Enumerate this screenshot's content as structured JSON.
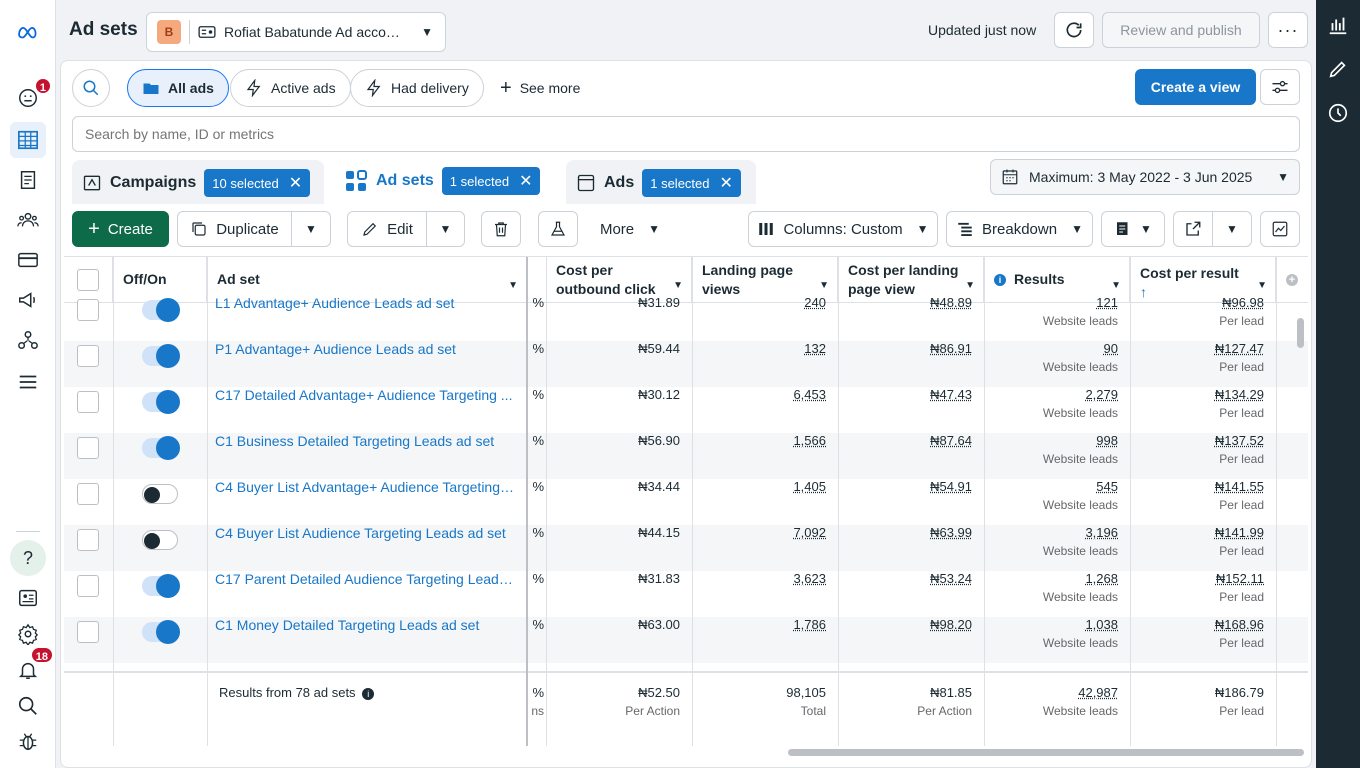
{
  "header": {
    "title": "Ad sets",
    "account_avatar": "B",
    "account_name": "Rofiat Babatunde Ad accou...",
    "updated": "Updated just now",
    "review_publish": "Review and publish"
  },
  "leftnav": {
    "notifications_badge": "1",
    "alerts_badge": "18",
    "help": "?"
  },
  "filters": {
    "all_ads": "All ads",
    "active_ads": "Active ads",
    "had_delivery": "Had delivery",
    "see_more": "See more",
    "create_view": "Create a view",
    "search_placeholder": "Search by name, ID or metrics"
  },
  "tabs": {
    "campaigns": {
      "label": "Campaigns",
      "selected": "10 selected"
    },
    "ad_sets": {
      "label": "Ad sets",
      "selected": "1 selected"
    },
    "ads": {
      "label": "Ads",
      "selected": "1 selected"
    }
  },
  "date_range": "Maximum: 3 May 2022 - 3 Jun 2025",
  "toolbar": {
    "create": "Create",
    "duplicate": "Duplicate",
    "edit": "Edit",
    "more": "More",
    "columns": "Columns: Custom",
    "breakdown": "Breakdown"
  },
  "columns": {
    "off_on": "Off/On",
    "ad_set": "Ad set",
    "cost_outbound": "Cost per outbound click",
    "landing_views": "Landing page views",
    "cost_landing": "Cost per landing page view",
    "results": "Results",
    "cost_result": "Cost per result"
  },
  "rows": [
    {
      "name": "L1 Advantage+ Audience Leads ad set",
      "on": true,
      "cpc": "₦31.89",
      "lpv": "240",
      "clpv": "₦48.89",
      "results": "121",
      "results_sub": "Website leads",
      "cpr": "₦96.98",
      "cpr_sub": "Per lead"
    },
    {
      "name": "P1 Advantage+ Audience Leads ad set",
      "on": true,
      "cpc": "₦59.44",
      "lpv": "132",
      "clpv": "₦86.91",
      "results": "90",
      "results_sub": "Website leads",
      "cpr": "₦127.47",
      "cpr_sub": "Per lead"
    },
    {
      "name": "C17 Detailed Advantage+ Audience Targeting ...",
      "on": true,
      "cpc": "₦30.12",
      "lpv": "6,453",
      "clpv": "₦47.43",
      "results": "2,279",
      "results_sub": "Website leads",
      "cpr": "₦134.29",
      "cpr_sub": "Per lead"
    },
    {
      "name": "C1 Business Detailed Targeting Leads ad set",
      "on": true,
      "cpc": "₦56.90",
      "lpv": "1,566",
      "clpv": "₦87.64",
      "results": "998",
      "results_sub": "Website leads",
      "cpr": "₦137.52",
      "cpr_sub": "Per lead"
    },
    {
      "name": "C4 Buyer List Advantage+ Audience Targeting ...",
      "on": false,
      "cpc": "₦34.44",
      "lpv": "1,405",
      "clpv": "₦54.91",
      "results": "545",
      "results_sub": "Website leads",
      "cpr": "₦141.55",
      "cpr_sub": "Per lead"
    },
    {
      "name": "C4 Buyer List Audience Targeting Leads ad set",
      "on": false,
      "cpc": "₦44.15",
      "lpv": "7,092",
      "clpv": "₦63.99",
      "results": "3,196",
      "results_sub": "Website leads",
      "cpr": "₦141.99",
      "cpr_sub": "Per lead"
    },
    {
      "name": "C17 Parent Detailed Audience Targeting Leads ...",
      "on": true,
      "cpc": "₦31.83",
      "lpv": "3,623",
      "clpv": "₦53.24",
      "results": "1,268",
      "results_sub": "Website leads",
      "cpr": "₦152.11",
      "cpr_sub": "Per lead"
    },
    {
      "name": "C1 Money Detailed Targeting Leads ad set",
      "on": true,
      "cpc": "₦63.00",
      "lpv": "1,786",
      "clpv": "₦98.20",
      "results": "1,038",
      "results_sub": "Website leads",
      "cpr": "₦168.96",
      "cpr_sub": "Per lead"
    }
  ],
  "footer": {
    "label": "Results from 78 ad sets",
    "pct": "%",
    "pct_sub": "ns",
    "cpc": "₦52.50",
    "cpc_sub": "Per Action",
    "lpv": "98,105",
    "lpv_sub": "Total",
    "clpv": "₦81.85",
    "clpv_sub": "Per Action",
    "results": "42,987",
    "results_sub": "Website leads",
    "cpr": "₦186.79",
    "cpr_sub": "Per lead"
  },
  "pct_symbol": "%",
  "colors": {
    "accent": "#1877c8",
    "create_green": "#0e6b4a",
    "badge_red": "#c4122f"
  }
}
